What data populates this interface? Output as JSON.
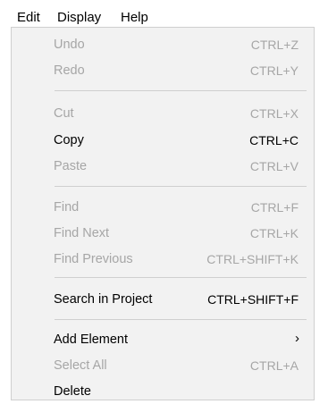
{
  "menubar": {
    "edit": "Edit",
    "display": "Display",
    "help": "Help"
  },
  "menu": {
    "undo": {
      "label": "Undo",
      "shortcut": "CTRL+Z"
    },
    "redo": {
      "label": "Redo",
      "shortcut": "CTRL+Y"
    },
    "cut": {
      "label": "Cut",
      "shortcut": "CTRL+X"
    },
    "copy": {
      "label": "Copy",
      "shortcut": "CTRL+C"
    },
    "paste": {
      "label": "Paste",
      "shortcut": "CTRL+V"
    },
    "find": {
      "label": "Find",
      "shortcut": "CTRL+F"
    },
    "find_next": {
      "label": "Find Next",
      "shortcut": "CTRL+K"
    },
    "find_previous": {
      "label": "Find Previous",
      "shortcut": "CTRL+SHIFT+K"
    },
    "search_in_project": {
      "label": "Search in Project",
      "shortcut": "CTRL+SHIFT+F"
    },
    "add_element": {
      "label": "Add Element",
      "submenu_glyph": "›"
    },
    "select_all": {
      "label": "Select All",
      "shortcut": "CTRL+A"
    },
    "delete": {
      "label": "Delete"
    }
  },
  "colors": {
    "enabled_text": "#000000",
    "disabled_text": "#a6a6a6",
    "menu_background": "#f2f2f2",
    "separator": "#cfcfcf"
  }
}
